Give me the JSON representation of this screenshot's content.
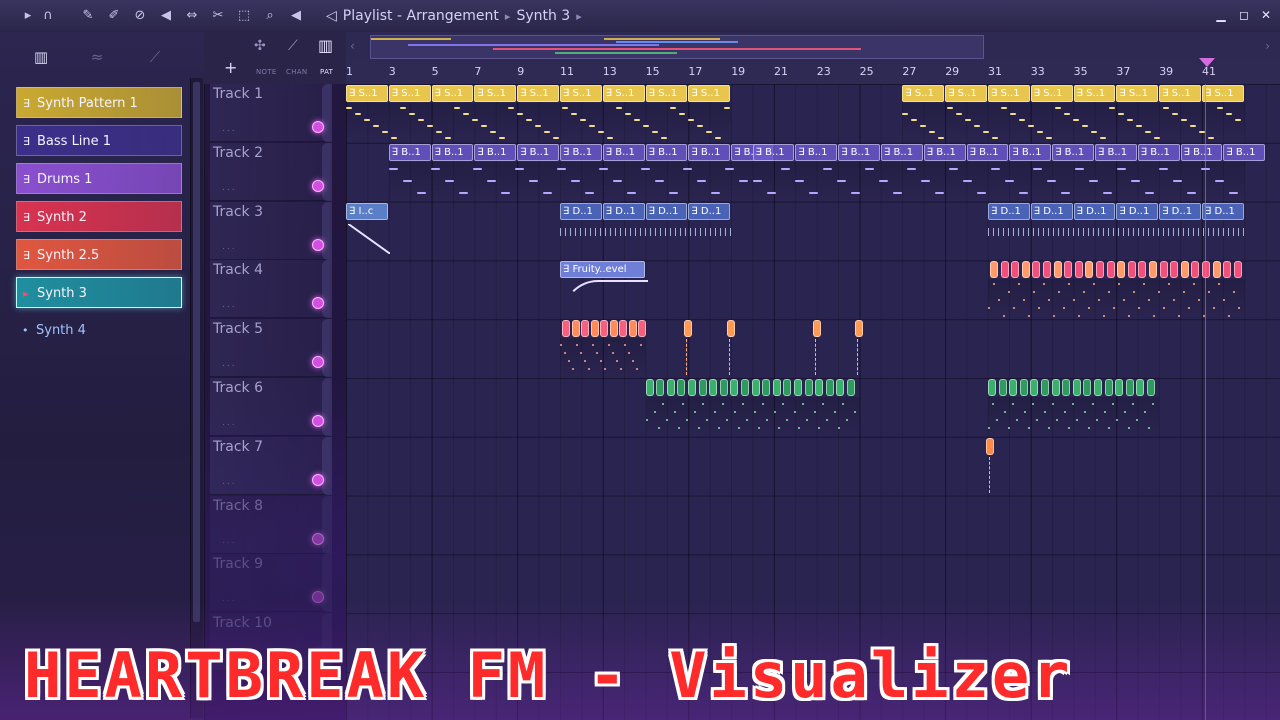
{
  "colors": {
    "accent": "#d14fe3",
    "grid_bg": "#2a2450",
    "title_text": "#ff2a2a"
  },
  "toolbar": {
    "icons": [
      "play-cursor-icon",
      "magnet-icon",
      "pencil-icon",
      "paint-icon",
      "delete-icon",
      "mute-icon",
      "slip-icon",
      "slice-icon",
      "select-icon",
      "zoom-icon",
      "playback-icon"
    ],
    "breadcrumb": {
      "section": "Playlist - Arrangement",
      "item": "Synth 3"
    },
    "window_buttons": [
      "minimize",
      "maximize",
      "close"
    ]
  },
  "picker": {
    "patterns": [
      {
        "label": "Synth Pattern 1",
        "color": "#c9a930"
      },
      {
        "label": "Bass Line 1",
        "color": "#3c2f8a"
      },
      {
        "label": "Drums 1",
        "color": "#8a4fcf"
      },
      {
        "label": "Synth 2",
        "color": "#d8334f"
      },
      {
        "label": "Synth 2.5",
        "color": "#e0573f"
      },
      {
        "label": "Synth 3",
        "color": "#1f8fa0",
        "selected": true
      },
      {
        "label": "Synth 4",
        "color": "#2a6cc0"
      }
    ]
  },
  "header_tools": {
    "add": "+",
    "note": "NOTE",
    "chan": "CHAN",
    "pat": "PAT"
  },
  "ruler": {
    "bars": [
      "1",
      "3",
      "5",
      "7",
      "9",
      "11",
      "13",
      "15",
      "17",
      "19",
      "21",
      "23",
      "25",
      "27",
      "29",
      "31",
      "33",
      "35",
      "37",
      "39",
      "41"
    ]
  },
  "tracks": [
    {
      "name": "Track 1"
    },
    {
      "name": "Track 2"
    },
    {
      "name": "Track 3"
    },
    {
      "name": "Track 4"
    },
    {
      "name": "Track 5"
    },
    {
      "name": "Track 6"
    },
    {
      "name": "Track 7"
    },
    {
      "name": "Track 8"
    },
    {
      "name": "Track 9"
    },
    {
      "name": "Track 10"
    }
  ],
  "clip_labels": {
    "synth_pattern": "S..1",
    "bass": "B..1",
    "drums": "D..1",
    "automation_short": "I..c",
    "automation": "Fruity..evel"
  },
  "overlay_title": "HEARTBREAK FM - Visualizer"
}
